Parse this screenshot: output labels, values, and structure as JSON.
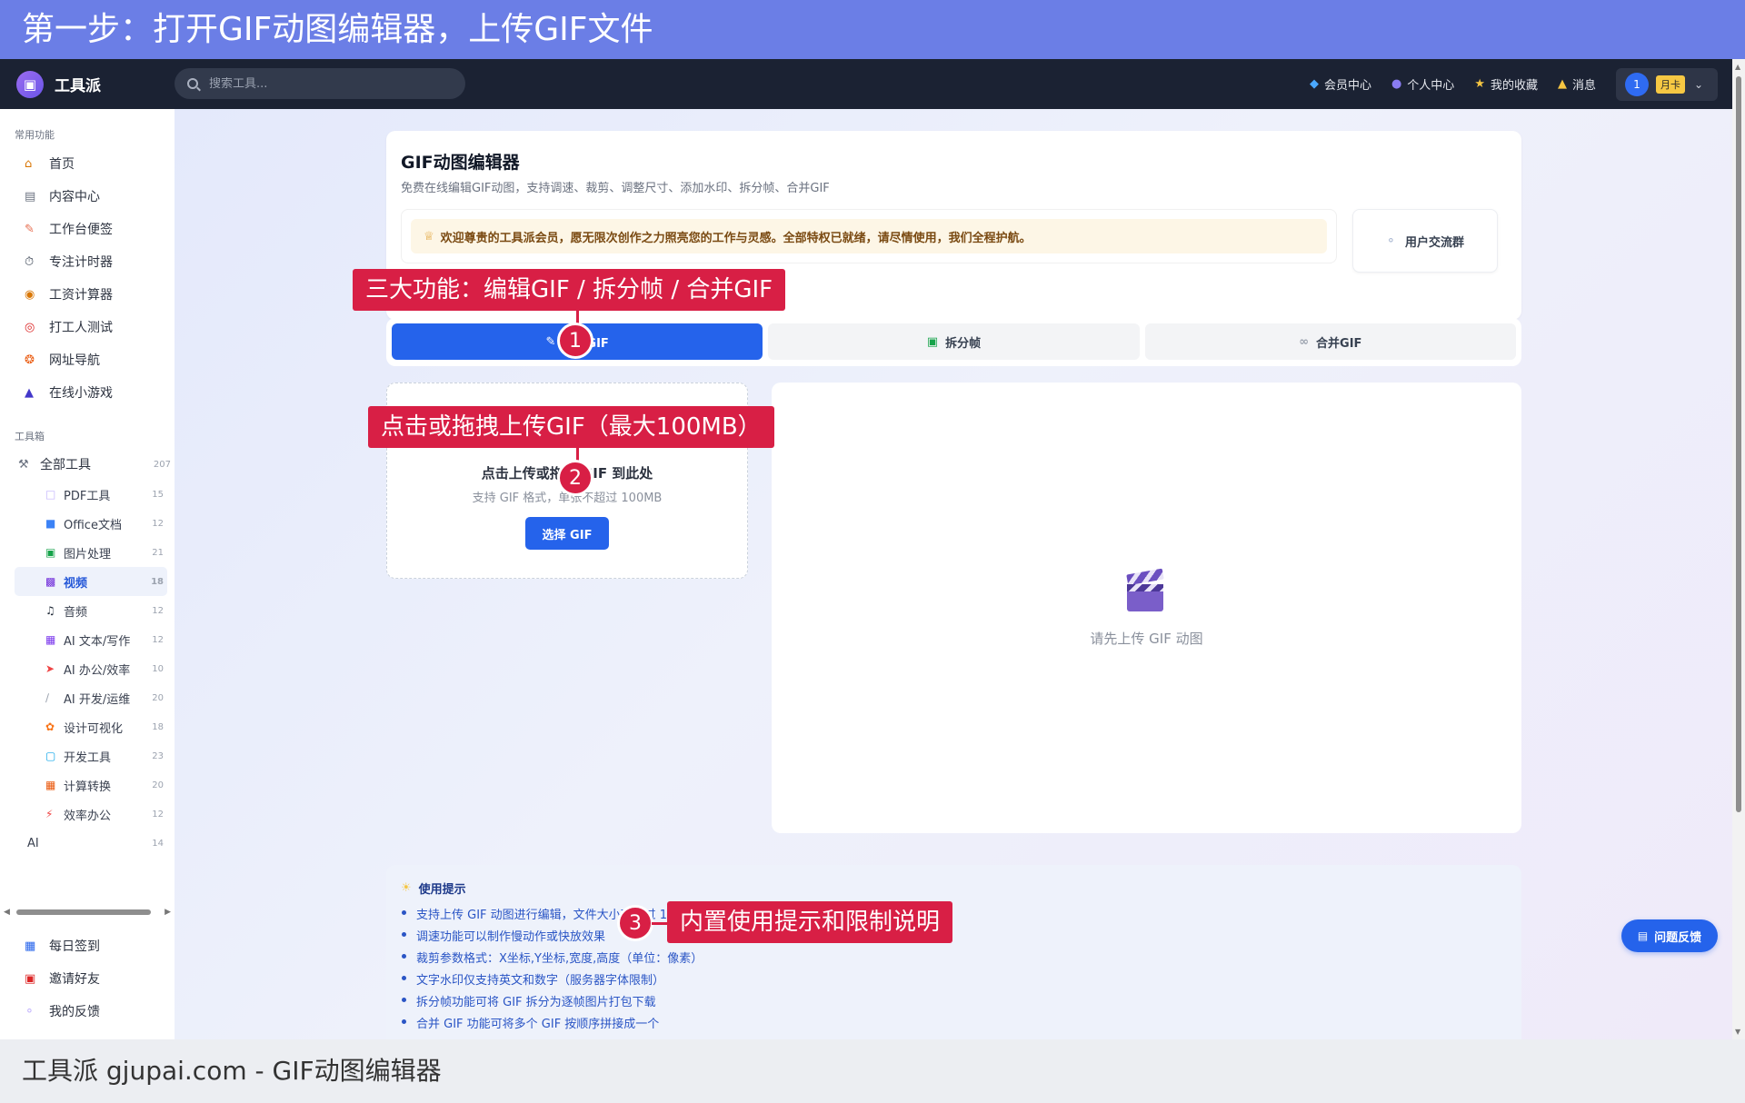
{
  "banner": {
    "title": "第一步：打开GIF动图编辑器，上传GIF文件"
  },
  "header": {
    "logo_icon": "briefcase-icon",
    "app_name": "工具派",
    "search_placeholder": "搜索工具...",
    "nav": [
      {
        "label": "会员中心",
        "icon": "diamond-icon"
      },
      {
        "label": "个人中心",
        "icon": "person-icon"
      },
      {
        "label": "我的收藏",
        "icon": "star-icon"
      },
      {
        "label": "消息",
        "icon": "bell-icon"
      }
    ],
    "user_avatar": "1",
    "plan_badge": "月卡"
  },
  "sidebar": {
    "section_common": "常用功能",
    "common_items": [
      {
        "label": "首页",
        "icon": "home-icon"
      },
      {
        "label": "内容中心",
        "icon": "newspaper-icon"
      },
      {
        "label": "工作台便签",
        "icon": "memo-icon"
      },
      {
        "label": "专注计时器",
        "icon": "timer-icon"
      },
      {
        "label": "工资计算器",
        "icon": "money-bag-icon"
      },
      {
        "label": "打工人测试",
        "icon": "target-icon"
      },
      {
        "label": "网址导航",
        "icon": "compass-icon"
      },
      {
        "label": "在线小游戏",
        "icon": "gamepad-icon"
      }
    ],
    "section_tools": "工具箱",
    "all_tools": {
      "label": "全部工具",
      "count": "207"
    },
    "categories": [
      {
        "label": "PDF工具",
        "count": "15",
        "icon": "pdf-icon"
      },
      {
        "label": "Office文档",
        "count": "12",
        "icon": "document-icon"
      },
      {
        "label": "图片处理",
        "count": "21",
        "icon": "image-icon"
      },
      {
        "label": "视频",
        "count": "18",
        "icon": "clapper-icon",
        "active": true
      },
      {
        "label": "音频",
        "count": "12",
        "icon": "music-icon"
      },
      {
        "label": "AI 文本/写作",
        "count": "12",
        "icon": "robot-icon"
      },
      {
        "label": "AI 办公/效率",
        "count": "10",
        "icon": "rocket-icon"
      },
      {
        "label": "AI 开发/运维",
        "count": "20",
        "icon": "bone-icon"
      },
      {
        "label": "设计可视化",
        "count": "18",
        "icon": "palette-icon"
      },
      {
        "label": "开发工具",
        "count": "23",
        "icon": "monitor-icon"
      },
      {
        "label": "计算转换",
        "count": "20",
        "icon": "abacus-icon"
      },
      {
        "label": "效率办公",
        "count": "12",
        "icon": "lightning-icon"
      },
      {
        "label": "AI",
        "count": "14",
        "icon": ""
      }
    ],
    "bottom_items": [
      {
        "label": "每日签到",
        "icon": "calendar-icon"
      },
      {
        "label": "邀请好友",
        "icon": "gift-icon"
      },
      {
        "label": "我的反馈",
        "icon": "speech-bubble-icon"
      }
    ]
  },
  "main": {
    "title": "GIF动图编辑器",
    "subtitle": "免费在线编辑GIF动图，支持调速、裁剪、调整尺寸、添加水印、拆分帧、合并GIF",
    "welcome": "欢迎尊贵的工具派会员，愿无限次创作之力照亮您的工作与灵感。全部特权已就绪，请尽情使用，我们全程护航。",
    "group_button": "用户交流群",
    "tabs": [
      {
        "label": "编辑GIF",
        "icon": "pencil-icon",
        "active": true
      },
      {
        "label": "拆分帧",
        "icon": "image-icon"
      },
      {
        "label": "合并GIF",
        "icon": "link-icon"
      }
    ],
    "upload": {
      "title": "点击上传或拖拽 GIF 到此处",
      "hint": "支持 GIF 格式，单张不超过 100MB",
      "button": "选择 GIF"
    },
    "preview_placeholder": "请先上传 GIF 动图",
    "tips": {
      "title": "使用提示",
      "items": [
        "支持上传 GIF 动图进行编辑，文件大小不超过 100MB",
        "调速功能可以制作慢动作或快放效果",
        "裁剪参数格式：X坐标,Y坐标,宽度,高度（单位：像素）",
        "文字水印仅支持英文和数字（服务器字体限制）",
        "拆分帧功能可将 GIF 拆分为逐帧图片打包下载",
        "合并 GIF 功能可将多个 GIF 按顺序拼接成一个"
      ]
    },
    "feedback_button": "问题反馈"
  },
  "annotations": [
    {
      "number": "1",
      "text": "三大功能：编辑GIF / 拆分帧 / 合并GIF"
    },
    {
      "number": "2",
      "text": "点击或拖拽上传GIF（最大100MB）"
    },
    {
      "number": "3",
      "text": "内置使用提示和限制说明"
    }
  ],
  "footer": {
    "text": "工具派 gjupai.com - GIF动图编辑器"
  },
  "colors": {
    "accent": "#2563eb",
    "annotation": "#d81f45",
    "banner": "#6b7ee6",
    "header": "#1b2233"
  }
}
